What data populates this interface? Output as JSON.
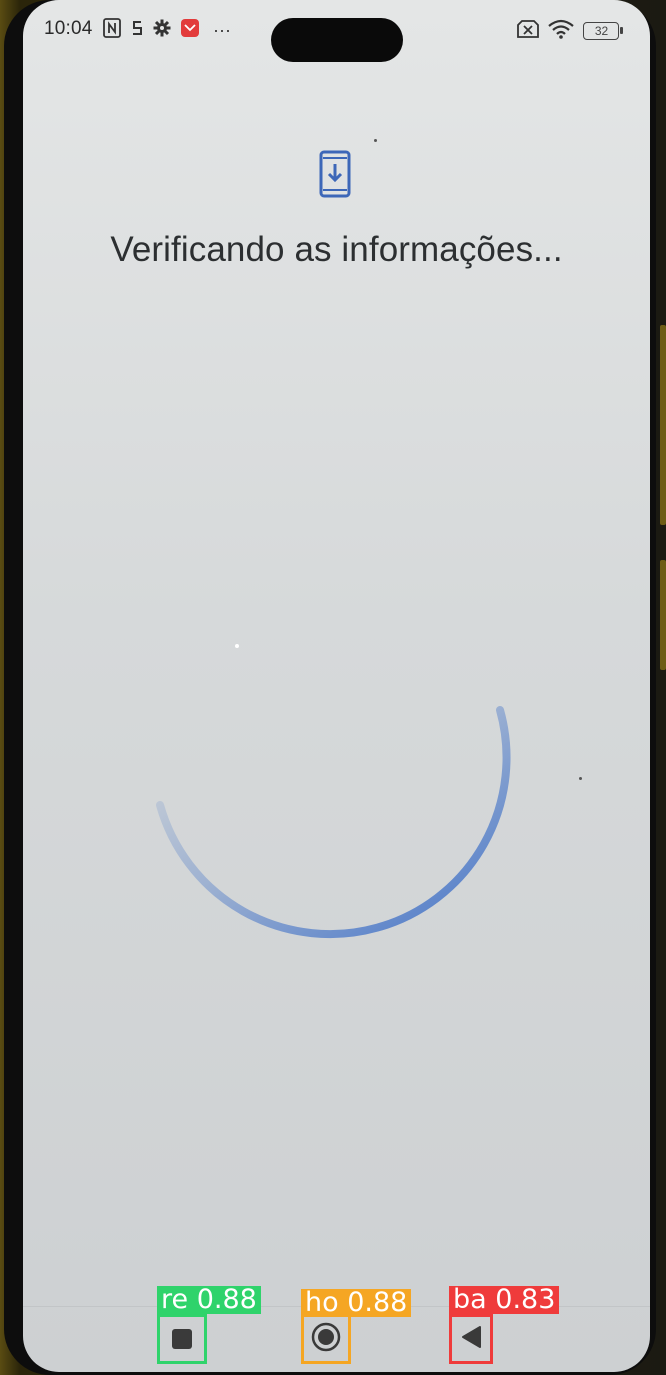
{
  "status_bar": {
    "time": "10:04",
    "battery": "32",
    "more_glyph": "···",
    "icons_left": [
      "nfc-icon",
      "sync-s-icon",
      "settings-gear-icon",
      "app-notification-icon"
    ],
    "icons_right": [
      "no-sim-icon",
      "wifi-icon",
      "battery-icon"
    ]
  },
  "main": {
    "icon": "phone-download-icon",
    "title": "Verificando as informações...",
    "spinner_color": "#3d6fc7"
  },
  "nav_bar": {
    "buttons": [
      {
        "name": "recents",
        "icon": "square-icon",
        "detection_label": "re  0.88",
        "box_color": "#2fd36b"
      },
      {
        "name": "home",
        "icon": "circle-icon",
        "detection_label": "ho  0.88",
        "box_color": "#f5a623"
      },
      {
        "name": "back",
        "icon": "triangle-back-icon",
        "detection_label": "ba  0.83",
        "box_color": "#ef3b3b"
      }
    ]
  }
}
